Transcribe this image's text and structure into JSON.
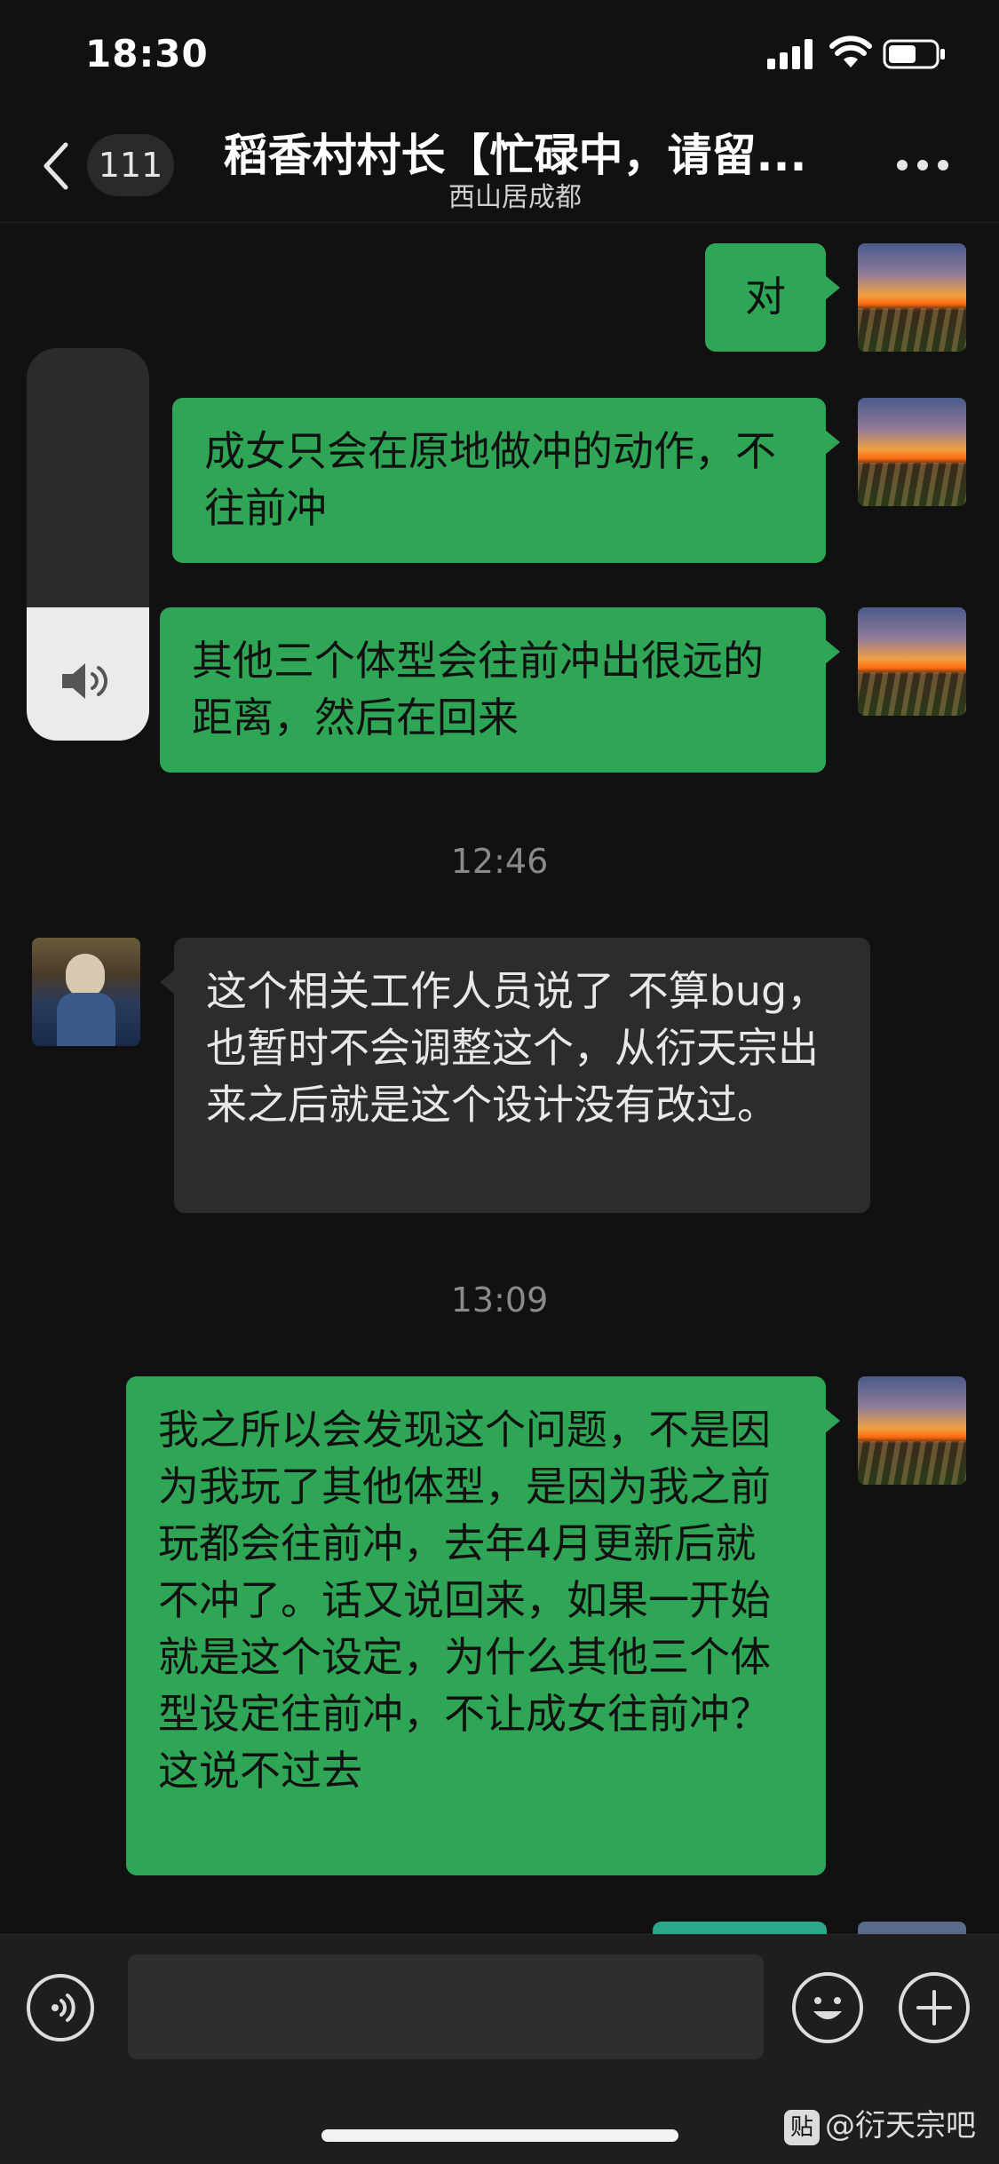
{
  "status_bar": {
    "time": "18:30"
  },
  "header": {
    "unread_count": "111",
    "title": "稻香村村长【忙碌中，请留...",
    "subtitle": "西山居成都"
  },
  "messages": [
    {
      "side": "right",
      "text": "对"
    },
    {
      "side": "right",
      "text": "成女只会在原地做冲的动作，不往前冲"
    },
    {
      "side": "right",
      "text": "其他三个体型会往前冲出很远的距离，然后在回来"
    },
    {
      "type": "timestamp",
      "text": "12:46"
    },
    {
      "side": "left",
      "text": "这个相关工作人员说了 不算bug，也暂时不会调整这个，从衍天宗出来之后就是这个设计没有改过。"
    },
    {
      "type": "timestamp",
      "text": "13:09"
    },
    {
      "side": "right",
      "text": "我之所以会发现这个问题，不是因为我玩了其他体型，是因为我之前玩都会往前冲，去年4月更新后就不冲了。话又说回来，如果一开始就是这个设定，为什么其他三个体型设定往前冲，不让成女往前冲？这说不过去"
    }
  ],
  "volume_overlay": {
    "level": 0.34,
    "icon": "speaker-icon"
  },
  "input_bar": {
    "icons": [
      "voice-icon",
      "emoji-icon",
      "plus-icon"
    ]
  },
  "watermark": {
    "badge": "贴",
    "text": "@衍天宗吧"
  },
  "colors": {
    "background": "#111111",
    "bubble_self": "#2ea655",
    "bubble_other": "#2c2c2c"
  }
}
